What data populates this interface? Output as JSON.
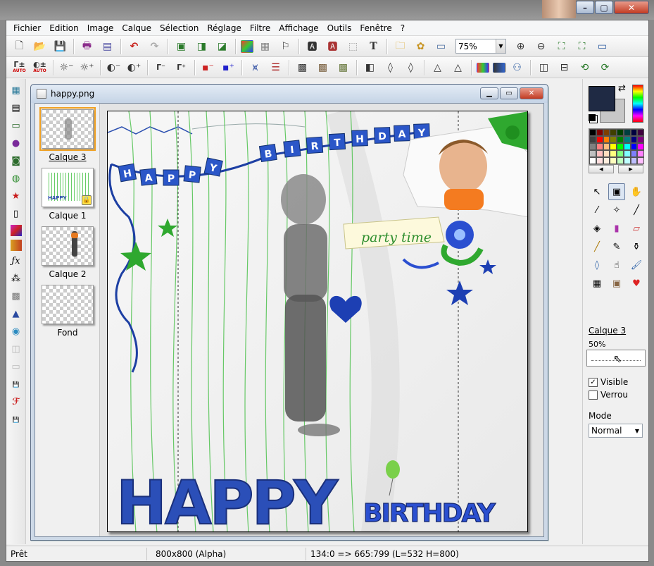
{
  "menu": [
    "Fichier",
    "Edition",
    "Image",
    "Calque",
    "Sélection",
    "Réglage",
    "Filtre",
    "Affichage",
    "Outils",
    "Fenêtre",
    "?"
  ],
  "toolbar1": {
    "zoom_value": "75%",
    "icons": [
      "new-file-icon",
      "open-folder-icon",
      "save-icon",
      "print-icon",
      "scan-icon",
      "undo-icon",
      "redo-icon",
      "layers-stack-icon",
      "layer-copy-icon",
      "layer-merge-icon",
      "color-gradient-icon",
      "grayscale-icon",
      "figure-icon",
      "text-frame-icon",
      "text-frame-2-icon",
      "select-icon",
      "text-tool-icon",
      "folder-tree-icon",
      "plugin-icon",
      "window-icon",
      "zoom-in-icon",
      "zoom-out-icon",
      "fit-window-icon",
      "full-view-icon",
      "slideshow-icon"
    ]
  },
  "toolbar2": {
    "auto_label": "AUTO",
    "icons": [
      "contrast-auto-icon",
      "levels-auto-icon",
      "brightness-down-icon",
      "brightness-up-icon",
      "contrast-down-icon",
      "contrast-up-icon",
      "gamma-down-icon",
      "gamma-up-icon",
      "saturation-down-icon",
      "saturation-up-icon",
      "histogram-icon",
      "balance-icon",
      "mosaic-1-icon",
      "mosaic-2-icon",
      "mosaic-3-icon",
      "blur-icon",
      "drop-icon",
      "drop-2-icon",
      "sharpen-icon",
      "sharpen-2-icon",
      "color-swap-icon",
      "color-channel-icon",
      "compare-icon",
      "mirror-icon",
      "flip-icon",
      "rotate-left-icon",
      "rotate-right-icon"
    ]
  },
  "document": {
    "title": "happy.png",
    "layers": [
      {
        "name": "Calque 3",
        "selected": true,
        "locked": false
      },
      {
        "name": "Calque 1",
        "selected": false,
        "locked": true
      },
      {
        "name": "Calque 2",
        "selected": false,
        "locked": false
      },
      {
        "name": "Fond",
        "selected": false,
        "locked": false
      }
    ],
    "artwork": {
      "banner_letters": [
        "H",
        "A",
        "P",
        "P",
        "Y",
        "B",
        "I",
        "R",
        "T",
        "H",
        "D",
        "A",
        "Y"
      ],
      "party_text": "party time",
      "happy_text": "HAPPY",
      "birthday_text": "BIRTHDAY"
    }
  },
  "right_panel": {
    "foreground_color": "#1f2a44",
    "background_color": "#c7c7c7",
    "palette": [
      "#000000",
      "#7f0000",
      "#7f3f00",
      "#3f3f00",
      "#003f00",
      "#003f3f",
      "#00003f",
      "#3f003f",
      "#3f3f3f",
      "#ff0000",
      "#ff7f00",
      "#7f7f00",
      "#007f00",
      "#007f7f",
      "#00007f",
      "#7f007f",
      "#7f7f7f",
      "#ff7f7f",
      "#ffbf7f",
      "#ffff00",
      "#00ff00",
      "#00ffff",
      "#0000ff",
      "#ff00ff",
      "#bfbfbf",
      "#ffbfbf",
      "#ffdfbf",
      "#ffff7f",
      "#7fff7f",
      "#7fffff",
      "#7f7fff",
      "#ff7fff",
      "#ffffff",
      "#ffdfdf",
      "#ffefdf",
      "#ffffbf",
      "#bfffbf",
      "#bfffff",
      "#bfbfff",
      "#ffbfff"
    ],
    "tools": [
      "arrow-icon",
      "layer-move-icon",
      "hand-icon",
      "eyedropper-icon",
      "magic-wand-icon",
      "line-icon",
      "fill-icon",
      "tube-icon",
      "eraser-icon",
      "brush-icon",
      "pen-icon",
      "stamp-icon",
      "drop-tool-icon",
      "smudge-icon",
      "paint-icon",
      "grid-tool-icon",
      "portrait-icon",
      "strawberry-icon"
    ],
    "layer_name": "Calque 3",
    "opacity_label": "50%",
    "opacity_value": 50,
    "visible_label": "Visible",
    "visible_checked": true,
    "lock_label": "Verrou",
    "lock_checked": false,
    "mode_label": "Mode",
    "mode_value": "Normal"
  },
  "statusbar": {
    "status": "Prêt",
    "size": "800x800 (Alpha)",
    "selection": "134:0 => 665:799 (L=532  H=800)"
  }
}
